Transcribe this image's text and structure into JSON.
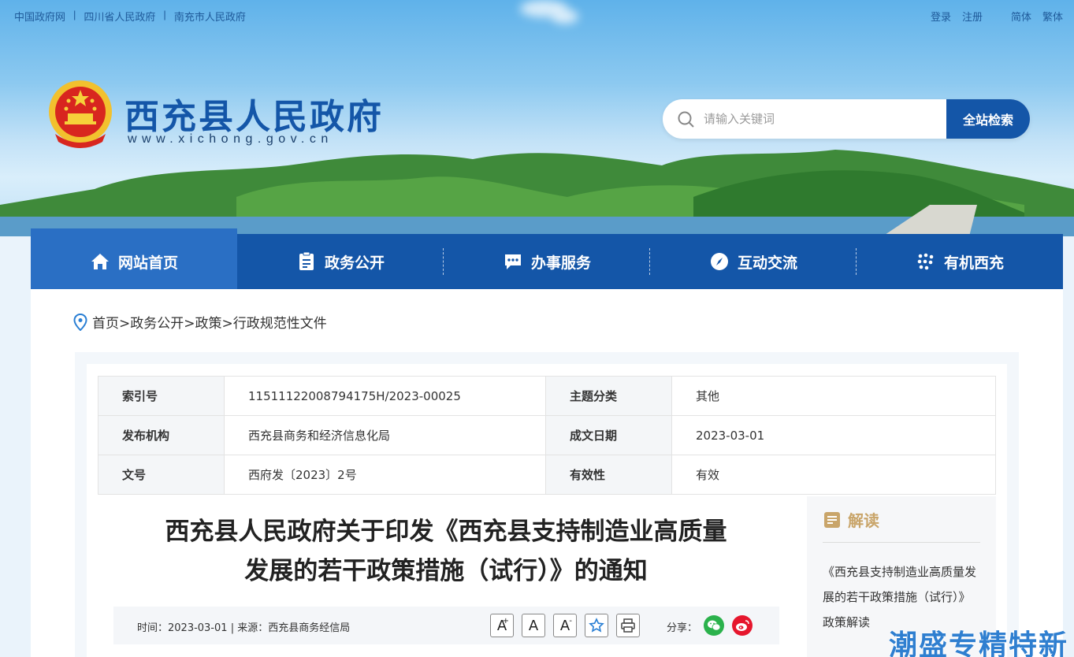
{
  "top_links": [
    "中国政府网",
    "四川省人民政府",
    "南充市人民政府"
  ],
  "top_right": {
    "login": "登录",
    "register": "注册",
    "simplified": "简体",
    "traditional": "繁体"
  },
  "site": {
    "title": "西充县人民政府",
    "url": "www.xichong.gov.cn"
  },
  "search": {
    "placeholder": "请输入关键词",
    "button": "全站检索"
  },
  "nav": [
    "网站首页",
    "政务公开",
    "办事服务",
    "互动交流",
    "有机西充"
  ],
  "breadcrumb": {
    "home": "首页",
    "items": [
      "政务公开",
      "政策",
      "行政规范性文件"
    ]
  },
  "meta": {
    "index_label": "索引号",
    "index_value": "11511122008794175H/2023-00025",
    "topic_label": "主题分类",
    "topic_value": "其他",
    "issuer_label": "发布机构",
    "issuer_value": "西充县商务和经济信息化局",
    "date_label": "成文日期",
    "date_value": "2023-03-01",
    "doc_label": "文号",
    "doc_value": "西府发〔2023〕2号",
    "validity_label": "有效性",
    "validity_value": "有效"
  },
  "article": {
    "title_line1": "西充县人民政府关于印发《西充县支持制造业高质量",
    "title_line2": "发展的若干政策措施（试行）》的通知",
    "time_label": "时间：",
    "time": "2023-03-01",
    "source_label": "来源：",
    "source": "西充县商务经信局",
    "font_up": "A",
    "font_normal": "A",
    "font_down": "A",
    "share_label": "分享："
  },
  "sidebar": {
    "heading": "解读",
    "link": "《西充县支持制造业高质量发展的若干政策措施（试行）》政策解读"
  },
  "watermark": "潮盛专精特新",
  "colors": {
    "brand_blue": "#1456a8",
    "nav_active": "#2a6fc4",
    "wechat": "#2bb24c",
    "weibo": "#e6162d",
    "gold": "#c9a56a"
  }
}
